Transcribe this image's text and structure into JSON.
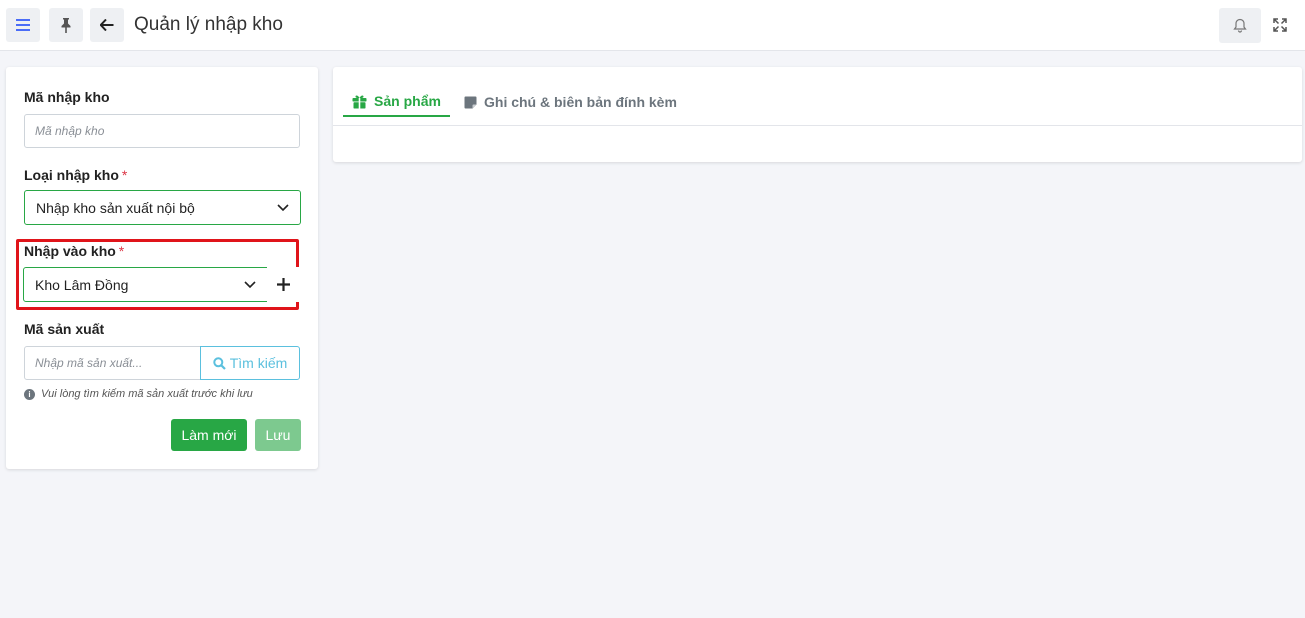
{
  "header": {
    "title": "Quản lý nhập kho"
  },
  "form": {
    "import_code": {
      "label": "Mã nhập kho",
      "placeholder": "Mã nhập kho"
    },
    "import_type": {
      "label": "Loại nhập kho",
      "required_mark": "*",
      "value": "Nhập kho sản xuất nội bộ"
    },
    "warehouse": {
      "label": "Nhập vào kho",
      "required_mark": "*",
      "value": "Kho Lâm Đồng"
    },
    "production_code": {
      "label": "Mã sản xuất",
      "placeholder": "Nhập mã sản xuất...",
      "search_label": "Tìm kiếm"
    },
    "hint": "Vui lòng tìm kiếm mã sản xuất trước khi lưu",
    "new_label": "Làm mới",
    "save_label": "Lưu"
  },
  "tabs": [
    {
      "label": "Sản phẩm",
      "active": true
    },
    {
      "label": "Ghi chú & biên bản đính kèm",
      "active": false
    }
  ],
  "colors": {
    "accent": "#28a745",
    "highlight_border": "#e0141a",
    "search_button": "#5bc0de",
    "menu_icon": "#4a6cf7"
  }
}
